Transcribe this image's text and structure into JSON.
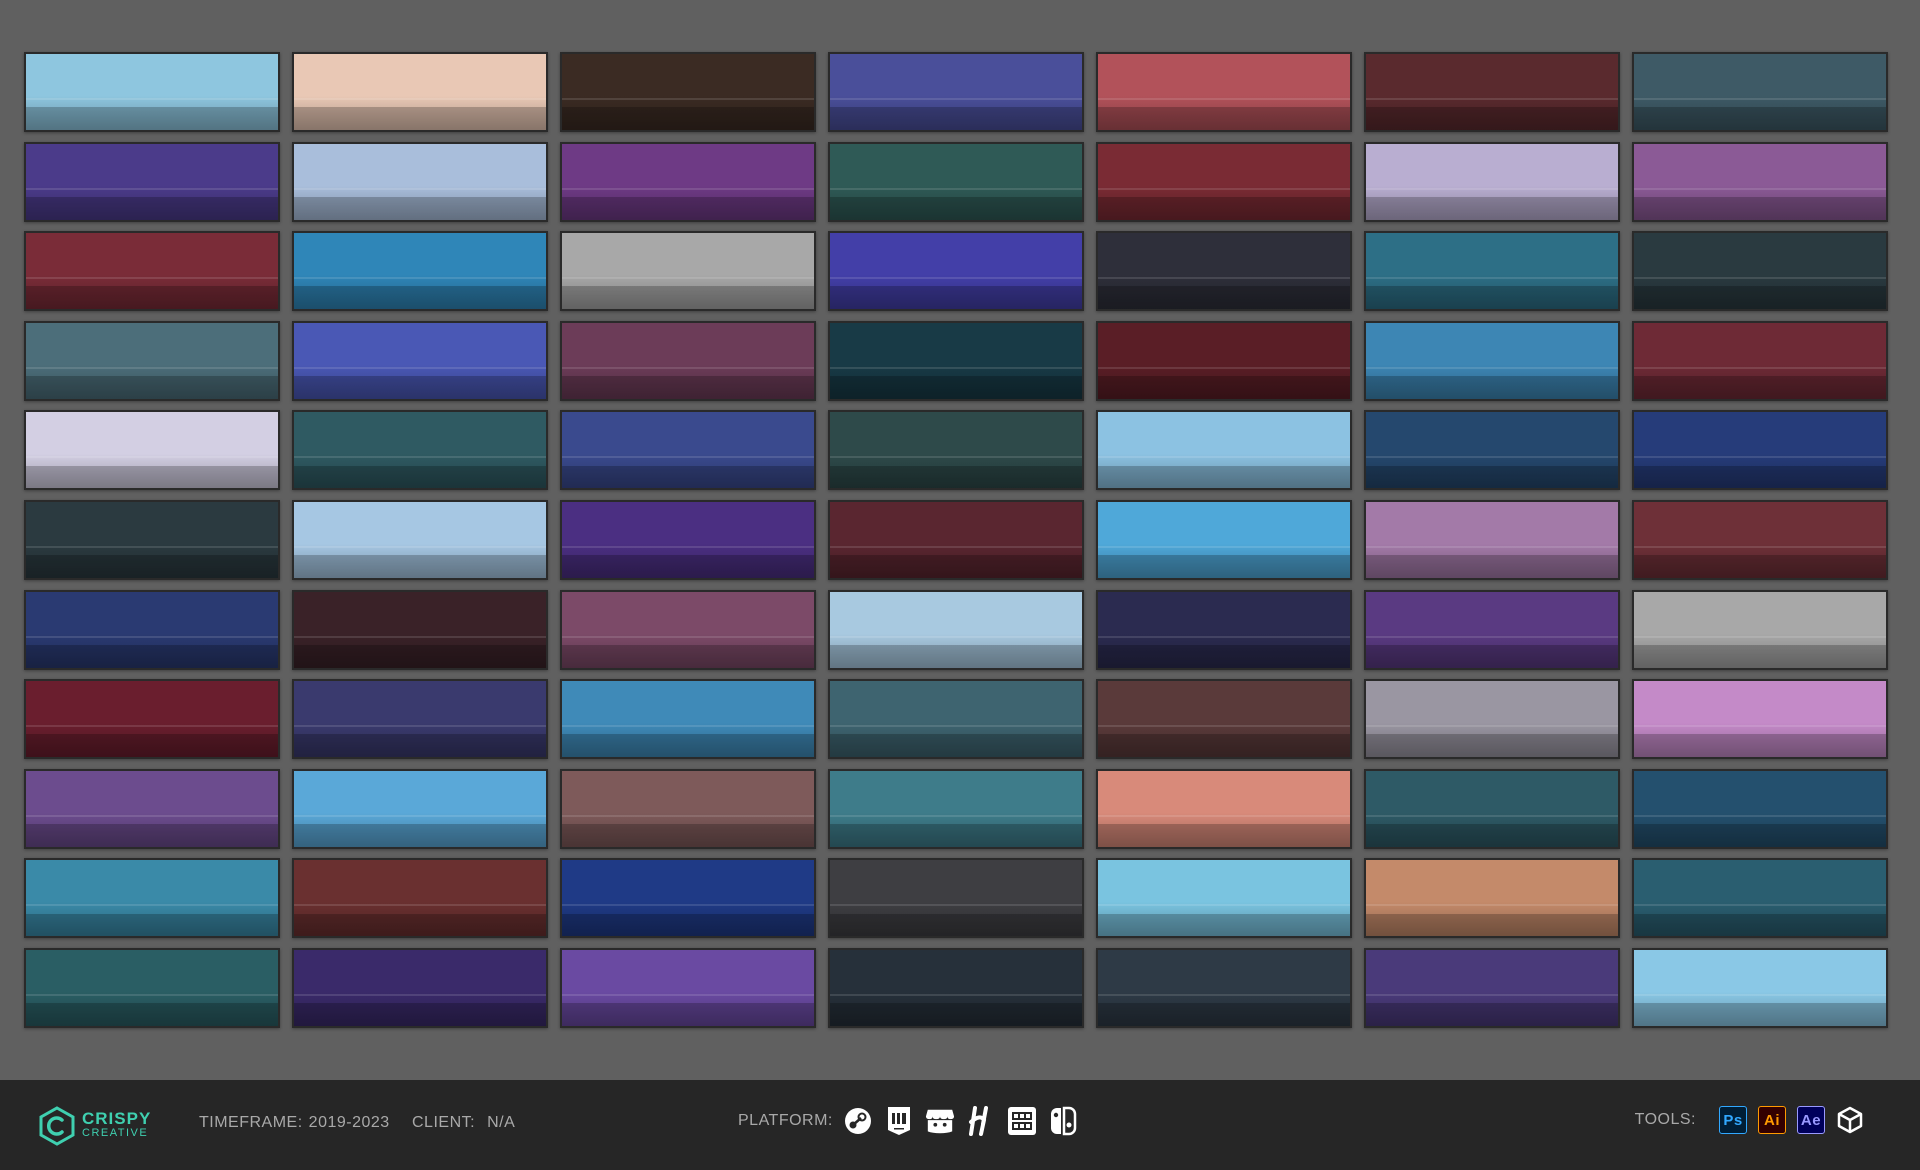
{
  "colors": {
    "background": "#606060",
    "footer": "#262626",
    "brand": "#3fd0b0",
    "footer_text": "#a9a9a9"
  },
  "thumbnails": [
    [
      "#8ec6df",
      "#e9c8b5",
      "#3b2b23",
      "#4a4f9a",
      "#b2525a",
      "#5a2a2e",
      "#3e5a66"
    ],
    [
      "#4b3b8a",
      "#a9bedb",
      "#6e3a85",
      "#2f5a56",
      "#7a2b34",
      "#b9aed1",
      "#8b5a96"
    ],
    [
      "#7a2c38",
      "#2f86b8",
      "#a8a8a8",
      "#433fa8",
      "#2e2f3a",
      "#2d6f86",
      "#2a3a40"
    ],
    [
      "#4c6e7a",
      "#4a58b5",
      "#6c3c58",
      "#183a46",
      "#5a1e26",
      "#3d86b4",
      "#6e2a36"
    ],
    [
      "#d3cfe3",
      "#2f5a62",
      "#3a4a8e",
      "#2e4a4a",
      "#8cc2e2",
      "#25486e",
      "#263c7a"
    ],
    [
      "#2b3a40",
      "#a6c7e3",
      "#4b2f82",
      "#5a2630",
      "#4fa8d9",
      "#a37aa8",
      "#6e3038"
    ],
    [
      "#2a3a72",
      "#3a2228",
      "#7c4a68",
      "#a8c9e0",
      "#2b2b50",
      "#5a3a82",
      "#a8a8a8"
    ],
    [
      "#6a1e2e",
      "#3a3a6e",
      "#3f8ab8",
      "#3e6470",
      "#5a3a3a",
      "#9a96a2",
      "#c48ac8"
    ],
    [
      "#6c4c8e",
      "#5aa8d8",
      "#7e5a5a",
      "#3e7c8a",
      "#d88a7a",
      "#2e5a66",
      "#24506e"
    ],
    [
      "#3a8aa8",
      "#6a3030",
      "#1f3a86",
      "#3e3e42",
      "#7ac4e0",
      "#c48a6a",
      "#2a5e70"
    ],
    [
      "#2a5e64",
      "#3a2a6a",
      "#6a4aa2",
      "#26303a",
      "#2e3a46",
      "#4a3a7a",
      "#8ac8e6"
    ]
  ],
  "footer": {
    "logo": {
      "line1": "CRISPY",
      "line2": "CREATIVE",
      "icon": "crispy-c-logo-icon"
    },
    "timeframe": {
      "label": "TIMEFRAME:",
      "value": "2019-2023"
    },
    "client": {
      "label": "CLIENT:",
      "value": "N/A"
    },
    "platform": {
      "label": "PLATFORM:",
      "icons": [
        "steam-icon",
        "epic-games-icon",
        "itch-io-icon",
        "humble-icon",
        "gog-icon",
        "nintendo-switch-icon"
      ]
    },
    "tools": {
      "label": "TOOLS:",
      "items": [
        {
          "text": "Ps",
          "icon": "photoshop-icon",
          "bg": "#001e36",
          "fg": "#31a8ff"
        },
        {
          "text": "Ai",
          "icon": "illustrator-icon",
          "bg": "#330000",
          "fg": "#ff9a00"
        },
        {
          "text": "Ae",
          "icon": "after-effects-icon",
          "bg": "#00005b",
          "fg": "#9999ff"
        }
      ],
      "extra_icon": "unity-icon"
    }
  }
}
